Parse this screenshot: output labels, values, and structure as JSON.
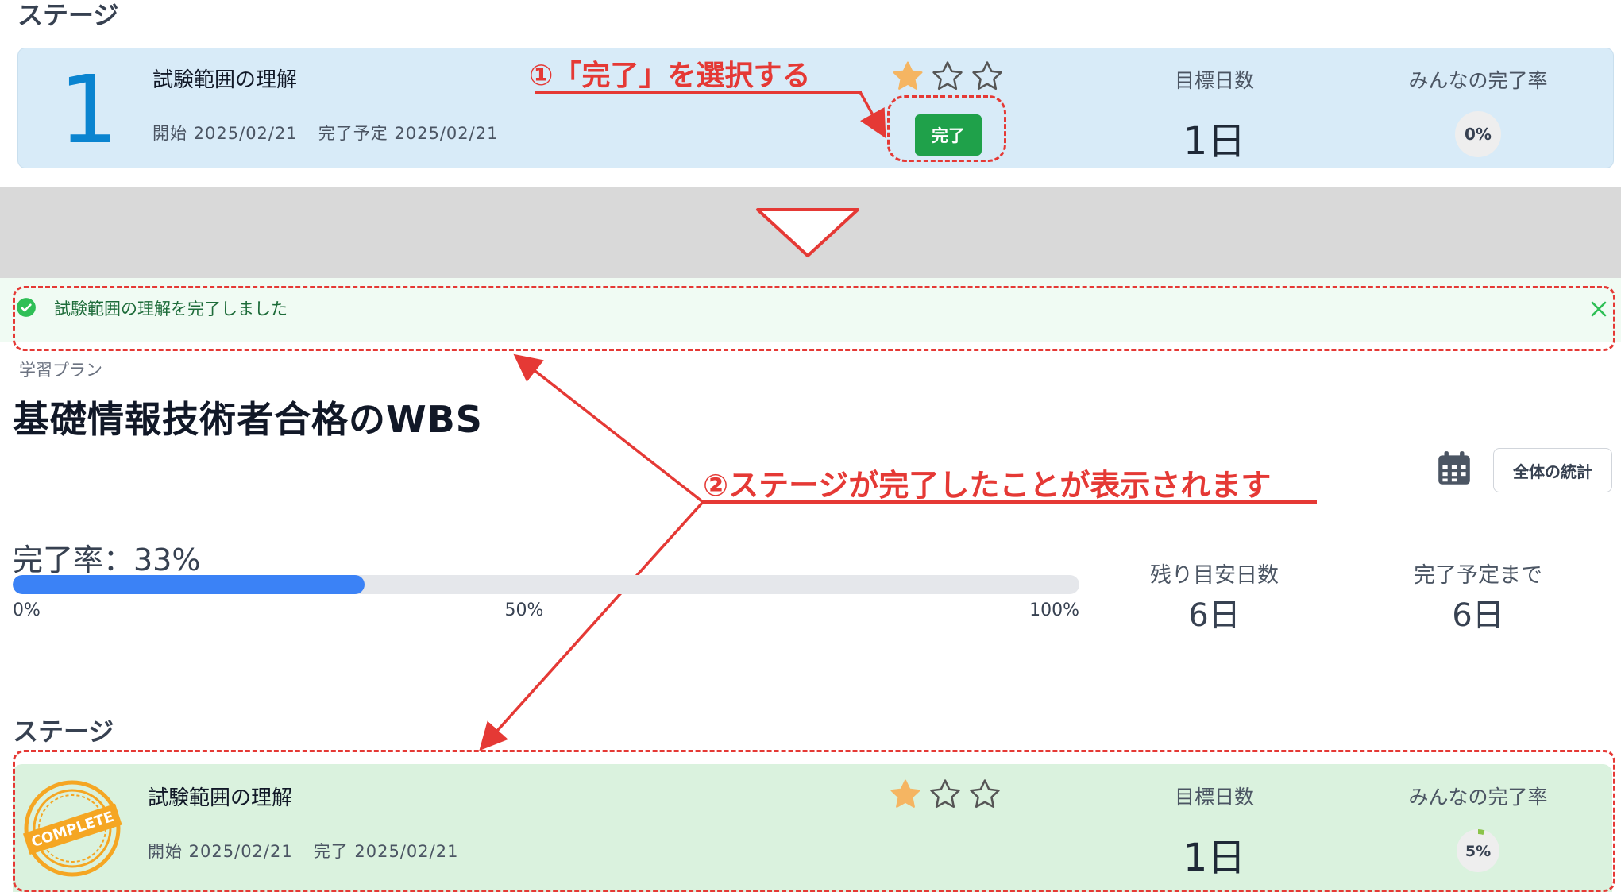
{
  "top": {
    "heading": "ステージ",
    "stage": {
      "number": "1",
      "title": "試験範囲の理解",
      "start": "開始 2025/02/21",
      "planned": "完了予定 2025/02/21",
      "complete_button": "完了",
      "target_days_label": "目標日数",
      "target_days": "1日",
      "everyone_rate_label": "みんなの完了率",
      "everyone_rate": "0%",
      "stars_filled": 1,
      "stars_total": 3
    }
  },
  "annotations": {
    "step1": "①「完了」を選択する",
    "step2": "②ステージが完了したことが表示されます"
  },
  "alert": {
    "message": "試験範囲の理解を完了しました"
  },
  "plan": {
    "label": "学習プラン",
    "title": "基礎情報技術者合格のWBS",
    "stats_button": "全体の統計",
    "completion_label": "完了率：33%",
    "completion_pct": 33,
    "axis_0": "0%",
    "axis_50": "50%",
    "axis_100": "100%",
    "remaining_days_label": "残り目安日数",
    "remaining_days": "6日",
    "until_planned_label": "完了予定まで",
    "until_planned": "6日"
  },
  "bottom": {
    "heading": "ステージ",
    "stage": {
      "badge_text": "COMPLETE",
      "title": "試験範囲の理解",
      "start": "開始 2025/02/21",
      "completed": "完了 2025/02/21",
      "target_days_label": "目標日数",
      "target_days": "1日",
      "everyone_rate_label": "みんなの完了率",
      "everyone_rate": "5%",
      "everyone_rate_value": 5,
      "stars_filled": 1,
      "stars_total": 3
    }
  },
  "colors": {
    "accent_red": "#e53935",
    "success_green": "#1fa14a",
    "progress_blue": "#3b82f6",
    "top_card_bg": "#d8ebf8",
    "bottom_card_bg": "#daf2de",
    "alert_bg": "#f0fbf3",
    "star_gold": "#f5b562",
    "badge_orange": "#f5a623"
  }
}
